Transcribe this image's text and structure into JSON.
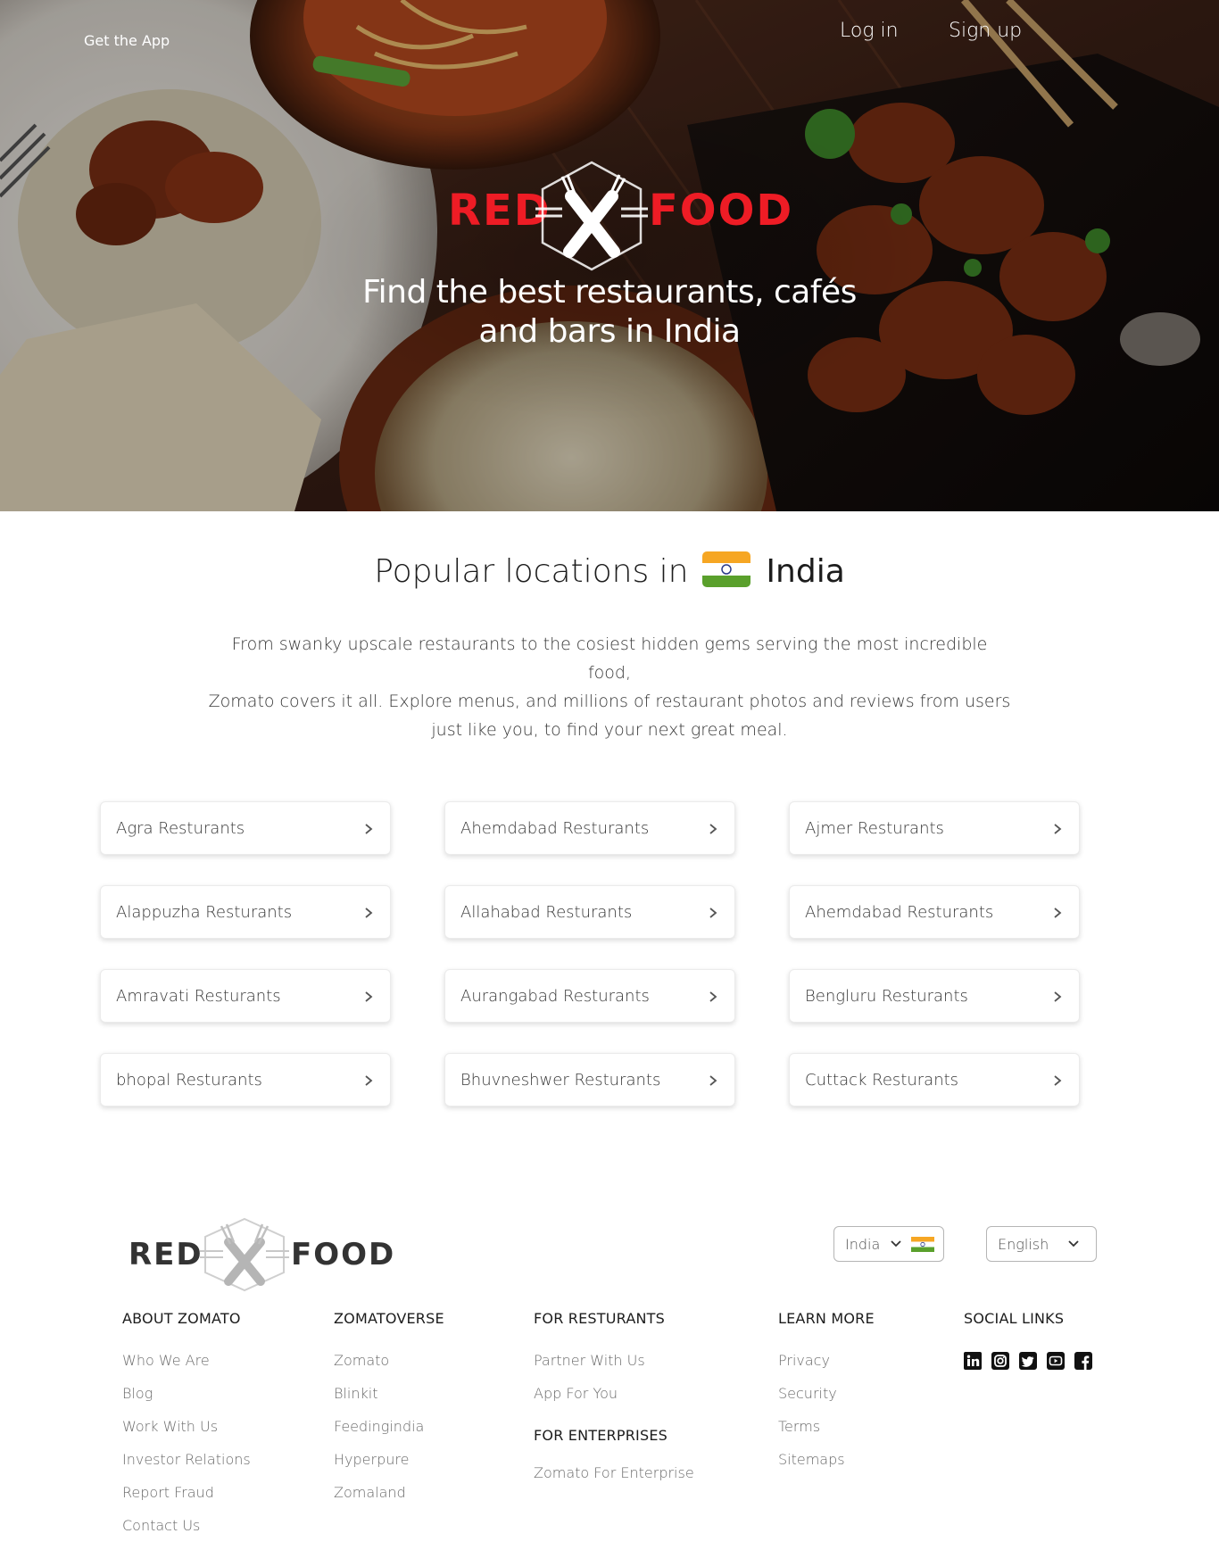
{
  "header": {
    "get_app": "Get the App",
    "login": "Log in",
    "signup": "Sign up"
  },
  "brand": {
    "word_left": "RED",
    "word_right": "FOOD"
  },
  "hero": {
    "tagline_line1": "Find the best restaurants, cafés",
    "tagline_line2": "and bars in India"
  },
  "popular": {
    "title_prefix": "Popular locations in",
    "country": "India",
    "description_line1": "From swanky upscale restaurants to the cosiest hidden gems serving the most incredible food,",
    "description_line2": "Zomato covers it all. Explore menus, and millions of restaurant photos and reviews from users",
    "description_line3": "just like you, to find your next great meal.",
    "locations": [
      "Agra Resturants",
      "Ahemdabad Resturants",
      "Ajmer Resturants",
      "Alappuzha Resturants",
      "Allahabad Resturants",
      "Ahemdabad Resturants",
      "Amravati Resturants",
      "Aurangabad Resturants",
      "Bengluru Resturants",
      "bhopal Resturants",
      "Bhuvneshwer Resturants",
      "Cuttack Resturants"
    ]
  },
  "footer": {
    "country_select": "India",
    "language_select": "English",
    "columns": {
      "about": {
        "heading": "ABOUT ZOMATO",
        "items": [
          "Who We Are",
          "Blog",
          "Work With Us",
          "Investor Relations",
          "Report Fraud",
          "Contact Us"
        ]
      },
      "zomatoverse": {
        "heading": "ZOMATOVERSE",
        "items": [
          "Zomato",
          "Blinkit",
          "Feedingindia",
          "Hyperpure",
          "Zomaland"
        ]
      },
      "restaurants": {
        "heading": "FOR RESTURANTS",
        "items": [
          "Partner With Us",
          "App For You"
        ],
        "heading2": "FOR ENTERPRISES",
        "items2": [
          "Zomato For Enterprise"
        ]
      },
      "learn": {
        "heading": "LEARN MORE",
        "items": [
          "Privacy",
          "Security",
          "Terms",
          "Sitemaps"
        ]
      },
      "social": {
        "heading": "SOCIAL LINKS",
        "icons": [
          "linkedin-icon",
          "instagram-icon",
          "twitter-icon",
          "youtube-icon",
          "facebook-icon"
        ]
      }
    }
  },
  "colors": {
    "brand_red": "#ee1c25",
    "footer_logo": "#333333",
    "muted_text": "#696969"
  }
}
